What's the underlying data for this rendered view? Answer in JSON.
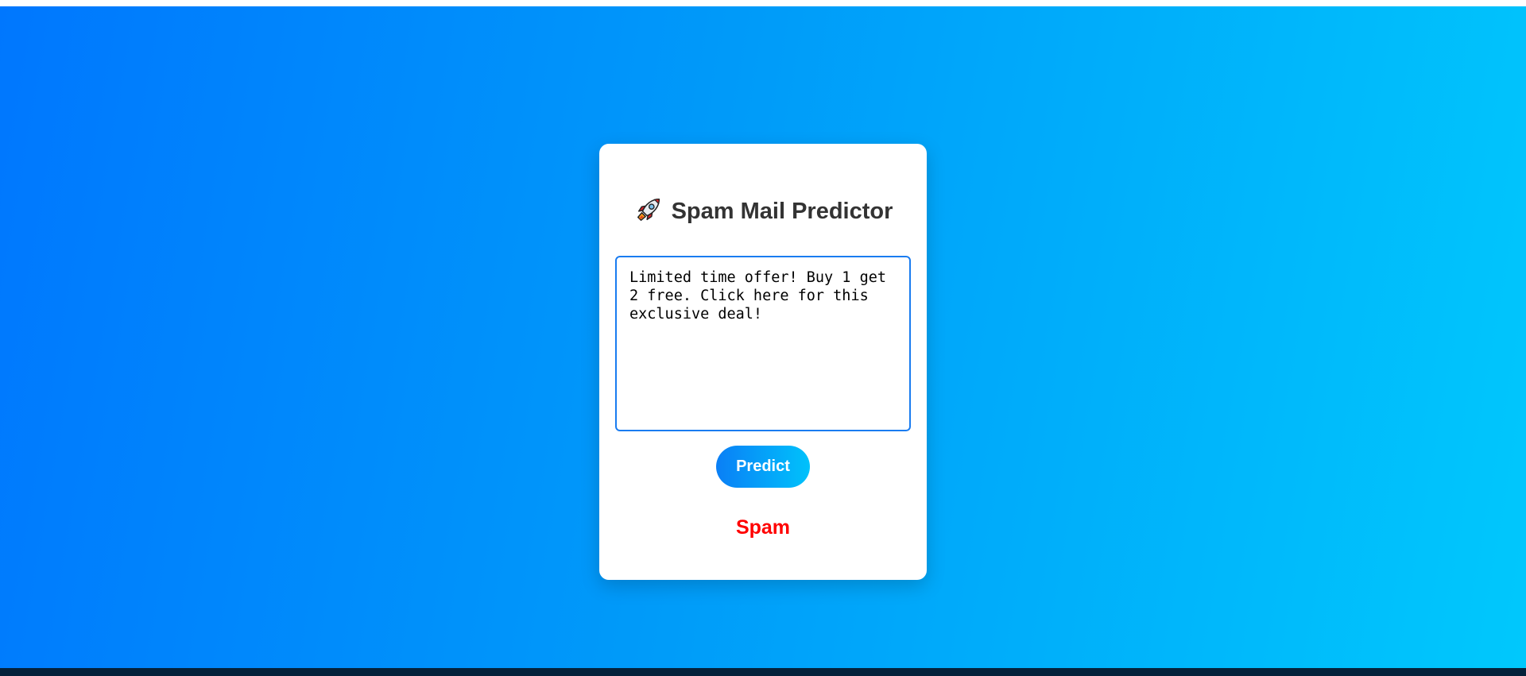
{
  "app": {
    "title": "Spam Mail Predictor",
    "title_icon": "rocket-icon"
  },
  "form": {
    "message_value": "Limited time offer! Buy 1 get 2 free. Click here for this exclusive deal!",
    "predict_label": "Predict"
  },
  "result": {
    "label": "Spam",
    "color": "#ff0000"
  },
  "colors": {
    "background_start": "#0077fe",
    "background_end": "#00c8fc",
    "accent": "#1a7cf0"
  }
}
